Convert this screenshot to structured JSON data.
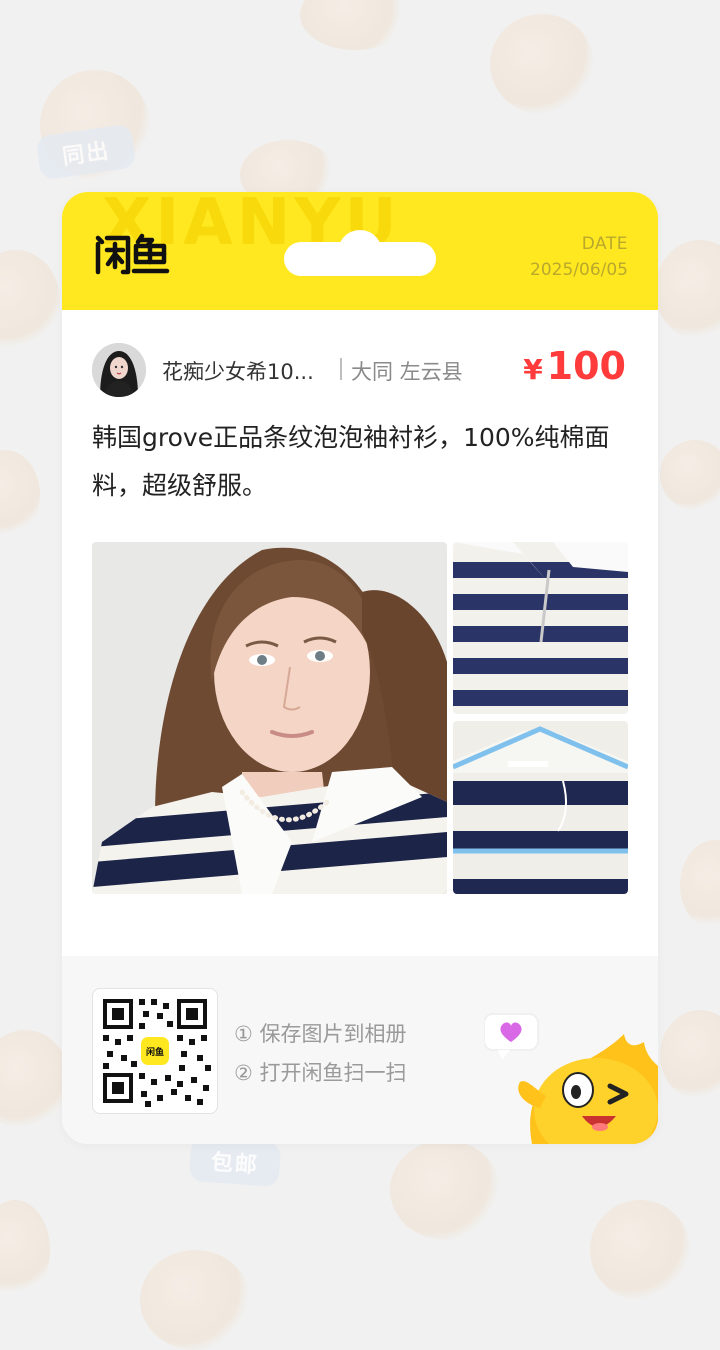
{
  "background": {
    "badge_top": "同出",
    "badge_bottom": "包邮"
  },
  "card": {
    "watermark": "XIANYU",
    "logo_icon": "xianyu-logo",
    "date_label": "DATE",
    "date_value": "2025/06/05",
    "colors": {
      "header": "#ffe81f",
      "price": "#ff3b3b"
    }
  },
  "seller": {
    "avatar_icon": "user-avatar",
    "name": "花痴少女希10...",
    "location": "大同 左云县"
  },
  "price": {
    "currency": "¥",
    "value": "100"
  },
  "description": "韩国grove正品条纹泡泡袖衬衫，100%纯棉面料，超级舒服。",
  "photos": [
    {
      "name": "model-photo"
    },
    {
      "name": "shirt-collar-photo"
    },
    {
      "name": "shirt-hanger-photo"
    }
  ],
  "footer": {
    "qr_icon": "qr-code",
    "step1": "① 保存图片到相册",
    "step2": "② 打开闲鱼扫一扫",
    "mascot_icon": "xianyu-mascot"
  }
}
